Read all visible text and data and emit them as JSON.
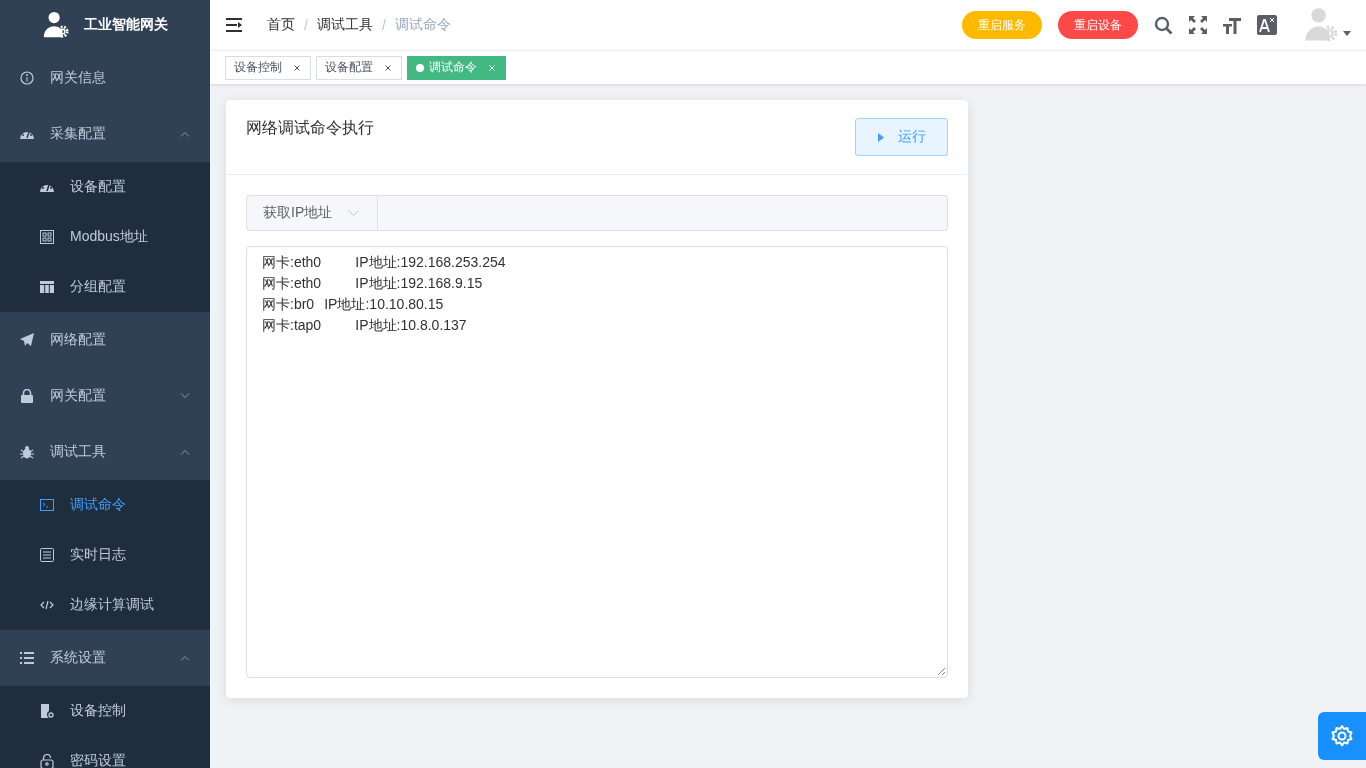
{
  "sidebar": {
    "title": "工业智能网关",
    "items": [
      {
        "label": "网关信息",
        "selected": false
      },
      {
        "label": "采集配置",
        "expanded": true,
        "selected": false,
        "children": [
          {
            "label": "设备配置",
            "selected": false
          },
          {
            "label": "Modbus地址",
            "selected": false
          },
          {
            "label": "分组配置",
            "selected": false
          }
        ]
      },
      {
        "label": "网络配置",
        "selected": false
      },
      {
        "label": "网关配置",
        "expanded": false,
        "selected": false
      },
      {
        "label": "调试工具",
        "expanded": true,
        "selected": false,
        "children": [
          {
            "label": "调试命令",
            "selected": true
          },
          {
            "label": "实时日志",
            "selected": false
          },
          {
            "label": "边缘计算调试",
            "selected": false
          }
        ]
      },
      {
        "label": "系统设置",
        "expanded": true,
        "selected": false,
        "children": [
          {
            "label": "设备控制",
            "selected": false
          },
          {
            "label": "密码设置",
            "selected": false
          }
        ]
      }
    ]
  },
  "breadcrumb": [
    "首页",
    "调试工具",
    "调试命令"
  ],
  "breadcrumb_separator": "/",
  "header_buttons": [
    {
      "label": "重启服务",
      "color": "#ffba00"
    },
    {
      "label": "重启设备",
      "color": "#ff4949"
    }
  ],
  "tabs": [
    {
      "label": "设备控制",
      "selected": false
    },
    {
      "label": "设备配置",
      "selected": false
    },
    {
      "label": "调试命令",
      "selected": true
    }
  ],
  "card": {
    "title": "网络调试命令执行",
    "run_button": "运行",
    "command_select": "获取IP地址",
    "output": [
      "网卡:eth0\t\tIP地址:192.168.253.254",
      "网卡:eth0\t\tIP地址:192.168.9.15",
      "网卡:br0\tIP地址:10.10.80.15",
      "网卡:tap0\t\tIP地址:10.8.0.137"
    ]
  }
}
